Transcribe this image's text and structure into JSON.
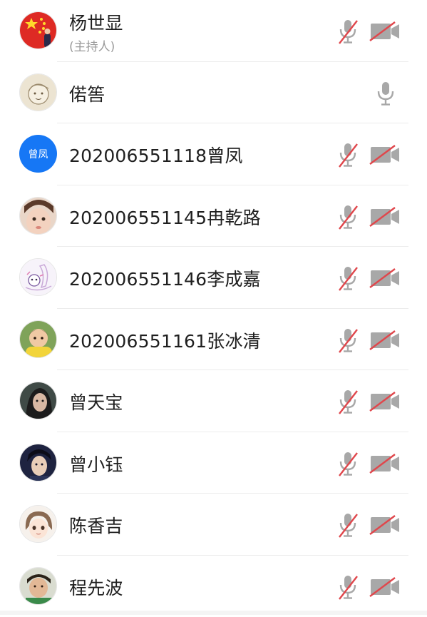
{
  "participants": [
    {
      "name": "杨世显",
      "role": "(主持人)",
      "avatar": "flag-avatar",
      "mic": "muted",
      "camera": "off"
    },
    {
      "name": "偌筶",
      "avatar": "sketch-avatar",
      "mic": "on",
      "camera": "none"
    },
    {
      "name": "202006551118曾凤",
      "avatar_text": "曾凤",
      "avatar": "text-avatar",
      "mic": "muted",
      "camera": "off"
    },
    {
      "name": "202006551145冉乾路",
      "avatar": "child-photo-avatar",
      "mic": "muted",
      "camera": "off"
    },
    {
      "name": "202006551146李成嘉",
      "avatar": "cartoon-avatar",
      "mic": "muted",
      "camera": "off"
    },
    {
      "name": "202006551161张冰清",
      "avatar": "kid-yellow-avatar",
      "mic": "muted",
      "camera": "off"
    },
    {
      "name": "曾天宝",
      "avatar": "portrait-avatar",
      "mic": "muted",
      "camera": "off"
    },
    {
      "name": "曾小钰",
      "avatar": "portrait-dark-avatar",
      "mic": "muted",
      "camera": "off"
    },
    {
      "name": "陈香吉",
      "avatar": "anime-girl-avatar",
      "mic": "muted",
      "camera": "off"
    },
    {
      "name": "程先波",
      "avatar": "boy-green-avatar",
      "mic": "muted",
      "camera": "off"
    }
  ],
  "colors": {
    "muted_slash": "#e0474c",
    "icon_gray": "#a8a8a8",
    "avatar_blue": "#1677f5"
  }
}
